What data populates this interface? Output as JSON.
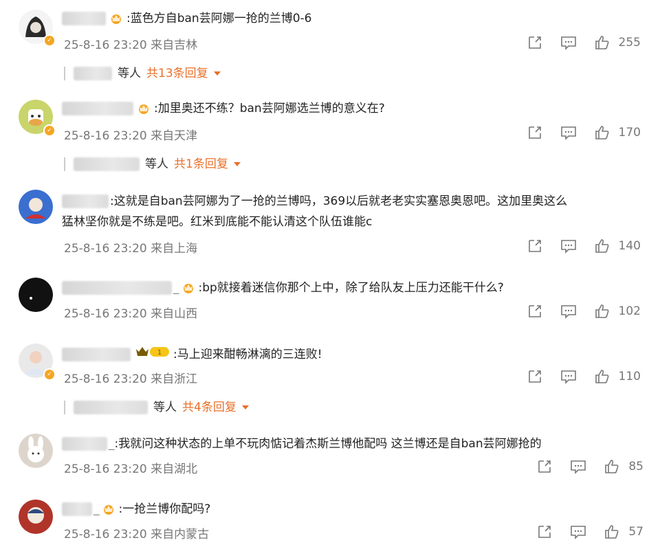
{
  "comments": [
    {
      "text": ":蓝色方自ban芸阿娜一抢的兰博0-6",
      "time": "25-8-16 23:20",
      "location": "来自吉林",
      "likes": "255",
      "replies": {
        "who": "等人",
        "count": "共13条回复"
      }
    },
    {
      "text": ":加里奥还不练？ban芸阿娜选兰博的意义在?",
      "time": "25-8-16 23:20",
      "location": "来自天津",
      "likes": "170",
      "replies": {
        "who": "等人",
        "count": "共1条回复"
      }
    },
    {
      "text_line1": ":这就是自ban芸阿娜为了一抢的兰博吗，369以后就老老实实塞恩奥恩吧。这加里奥这么",
      "text_line2": "猛林坚你就是不练是吧。红米到底能不能认清这个队伍谁能c",
      "time": "25-8-16 23:20",
      "location": "来自上海",
      "likes": "140"
    },
    {
      "text": ":bp就接着迷信你那个上中，除了给队友上压力还能干什么?",
      "time": "25-8-16 23:20",
      "location": "来自山西",
      "likes": "102"
    },
    {
      "text": ":马上迎来酣畅淋漓的三连败!",
      "time": "25-8-16 23:20",
      "location": "来自浙江",
      "likes": "110",
      "replies": {
        "who": "等人",
        "count": "共4条回复"
      }
    },
    {
      "text": ":我就问这种状态的上单不玩肉惦记着杰斯兰博他配吗 这兰博还是自ban芸阿娜抢的",
      "time": "25-8-16 23:20",
      "location": "来自湖北",
      "likes": "85"
    },
    {
      "text": ":一抢兰博你配吗?",
      "time": "25-8-16 23:20",
      "location": "来自内蒙古",
      "likes": "57"
    }
  ],
  "icons": {
    "share": "share-icon",
    "comment": "comment-icon",
    "like": "like-icon"
  },
  "colors": {
    "accent": "#e8702a",
    "badge": "#f5a623"
  }
}
